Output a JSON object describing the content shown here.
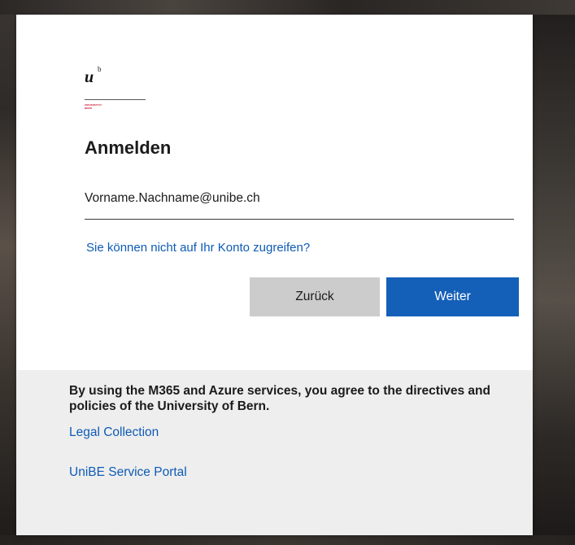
{
  "branding": {
    "logo_letter": "u",
    "logo_superscript": "b",
    "logo_line1": "UNIVERSITÄT",
    "logo_line2": "BERN",
    "accent_color": "#c8102e"
  },
  "signin": {
    "title": "Anmelden",
    "email_value": "Vorname.Nachname@unibe.ch",
    "cant_access_link": "Sie können nicht auf Ihr Konto zugreifen?",
    "back_button": "Zurück",
    "next_button": "Weiter",
    "primary_color": "#1460b8",
    "link_color": "#0e5bb5"
  },
  "footer": {
    "notice": "By using the M365 and Azure services, you agree to the directives and policies of the University of Bern.",
    "legal_link": "Legal Collection",
    "portal_link": "UniBE Service Portal"
  }
}
